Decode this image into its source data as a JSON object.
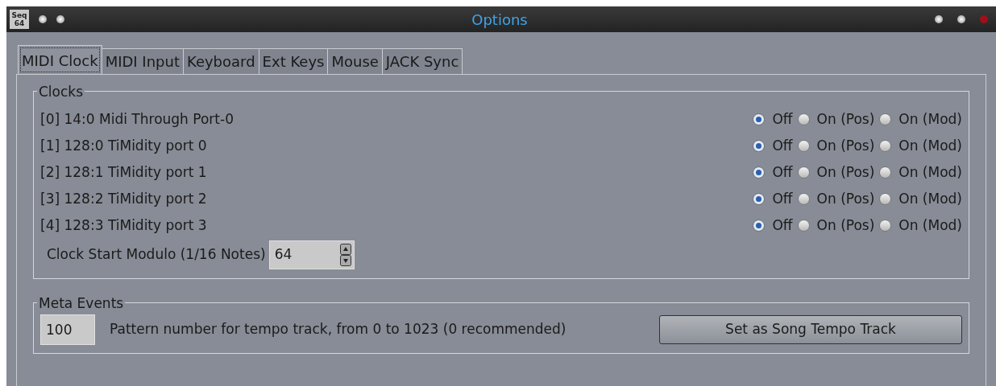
{
  "window": {
    "icon_text": "Seq 64",
    "title": "Options"
  },
  "tabs": [
    {
      "label": "MIDI Clock",
      "selected": true
    },
    {
      "label": "MIDI Input",
      "selected": false
    },
    {
      "label": "Keyboard",
      "selected": false
    },
    {
      "label": "Ext Keys",
      "selected": false
    },
    {
      "label": "Mouse",
      "selected": false
    },
    {
      "label": "JACK Sync",
      "selected": false
    }
  ],
  "clocks": {
    "title": "Clocks",
    "ports": [
      {
        "name": "[0] 14:0 Midi Through Port-0",
        "options": [
          {
            "label": "Off",
            "selected": true
          },
          {
            "label": "On (Pos)",
            "selected": false
          },
          {
            "label": "On (Mod)",
            "selected": false
          }
        ]
      },
      {
        "name": "[1] 128:0 TiMidity port 0",
        "options": [
          {
            "label": "Off",
            "selected": true
          },
          {
            "label": "On (Pos)",
            "selected": false
          },
          {
            "label": "On (Mod)",
            "selected": false
          }
        ]
      },
      {
        "name": "[2] 128:1 TiMidity port 1",
        "options": [
          {
            "label": "Off",
            "selected": true
          },
          {
            "label": "On (Pos)",
            "selected": false
          },
          {
            "label": "On (Mod)",
            "selected": false
          }
        ]
      },
      {
        "name": "[3] 128:2 TiMidity port 2",
        "options": [
          {
            "label": "Off",
            "selected": true
          },
          {
            "label": "On (Pos)",
            "selected": false
          },
          {
            "label": "On (Mod)",
            "selected": false
          }
        ]
      },
      {
        "name": "[4] 128:3 TiMidity port 3",
        "options": [
          {
            "label": "Off",
            "selected": true
          },
          {
            "label": "On (Pos)",
            "selected": false
          },
          {
            "label": "On (Mod)",
            "selected": false
          }
        ]
      }
    ],
    "modulo_label": "Clock Start Modulo (1/16 Notes)",
    "modulo_value": "64"
  },
  "meta_events": {
    "title": "Meta Events",
    "tempo_track_value": "100",
    "description": "Pattern number for tempo track, from 0 to 1023 (0 recommended)",
    "button": "Set as Song Tempo Track"
  }
}
